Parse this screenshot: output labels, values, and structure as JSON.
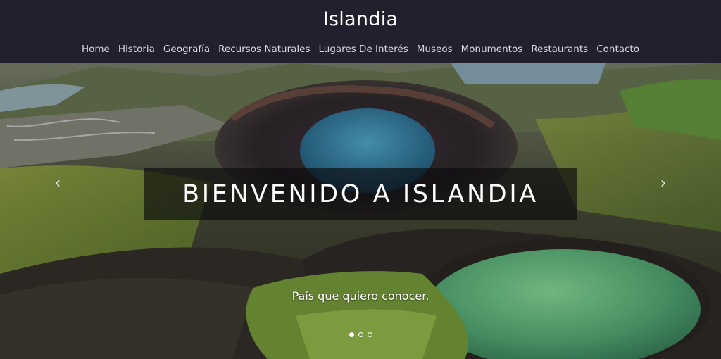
{
  "header": {
    "brand": "Islandia",
    "nav": [
      {
        "label": "Home"
      },
      {
        "label": "Historia"
      },
      {
        "label": "Geografía"
      },
      {
        "label": "Recursos Naturales"
      },
      {
        "label": "Lugares De Interés"
      },
      {
        "label": "Museos"
      },
      {
        "label": "Monumentos"
      },
      {
        "label": "Restaurants"
      },
      {
        "label": "Contacto"
      }
    ]
  },
  "carousel": {
    "title": "BIENVENIDO A ISLANDIA",
    "subtitle": "País que quiero conocer.",
    "prev_icon": "chevron-left-icon",
    "next_icon": "chevron-right-icon",
    "slides": 3,
    "active_slide": 1
  },
  "colors": {
    "header_bg": "#22202f",
    "nav_text": "#d9d7e0",
    "caption_bg": "rgba(10,10,12,0.66)"
  }
}
